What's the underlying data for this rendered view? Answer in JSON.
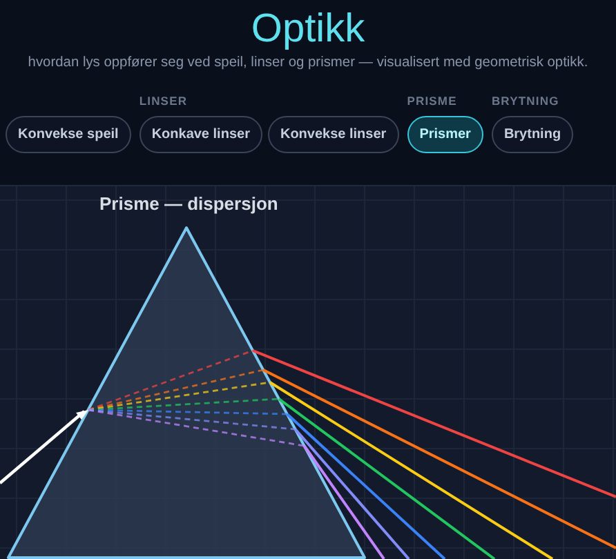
{
  "header": {
    "title": "Optikk",
    "subtitle": "hvordan lys oppfører seg ved speil, linser og prismer — visualisert med geometrisk optikk."
  },
  "tab_groups": [
    {
      "tabs": [
        {
          "label": "Konvekse speil",
          "selected": false
        }
      ]
    },
    {
      "label": "LINSER",
      "tabs": [
        {
          "label": "Konkave linser",
          "selected": false
        },
        {
          "label": "Konvekse linser",
          "selected": false
        }
      ]
    },
    {
      "label": "PRISME",
      "tabs": [
        {
          "label": "Prismer",
          "selected": true
        }
      ]
    },
    {
      "label": "BRYTNING",
      "tabs": [
        {
          "label": "Brytning",
          "selected": false
        }
      ]
    }
  ],
  "canvas": {
    "title": "Prisme — dispersjon"
  }
}
